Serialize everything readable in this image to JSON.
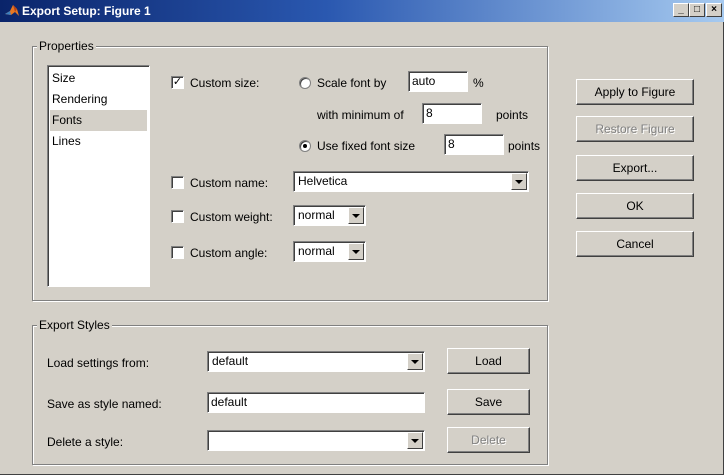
{
  "window": {
    "title": "Export Setup: Figure 1",
    "minimize_glyph": "_",
    "maximize_glyph": "□",
    "close_glyph": "×"
  },
  "properties": {
    "legend": "Properties",
    "categories": [
      "Size",
      "Rendering",
      "Fonts",
      "Lines"
    ],
    "selected_category": "Fonts",
    "custom_size": {
      "label": "Custom size:",
      "checked": true,
      "scale_font_label": "Scale font by",
      "scale_font_value": "auto",
      "scale_font_unit": "%",
      "scale_font_selected": false,
      "min_label": "with minimum of",
      "min_value": "8",
      "min_unit": "points",
      "fixed_label": "Use fixed font size",
      "fixed_value": "8",
      "fixed_unit": "points",
      "fixed_selected": true
    },
    "custom_name": {
      "label": "Custom name:",
      "checked": false,
      "value": "Helvetica"
    },
    "custom_weight": {
      "label": "Custom weight:",
      "checked": false,
      "value": "normal"
    },
    "custom_angle": {
      "label": "Custom angle:",
      "checked": false,
      "value": "normal"
    }
  },
  "side_buttons": {
    "apply": "Apply to Figure",
    "restore": "Restore Figure",
    "export": "Export...",
    "ok": "OK",
    "cancel": "Cancel"
  },
  "export_styles": {
    "legend": "Export Styles",
    "load_label": "Load settings from:",
    "load_value": "default",
    "load_button": "Load",
    "save_label": "Save as style named:",
    "save_value": "default",
    "save_button": "Save",
    "delete_label": "Delete a style:",
    "delete_value": "",
    "delete_button": "Delete"
  },
  "colors": {
    "dialog_bg": "#d4d0c8",
    "titlebar_start": "#0a246a",
    "titlebar_end": "#a6caf0",
    "disabled_text": "#808080"
  }
}
